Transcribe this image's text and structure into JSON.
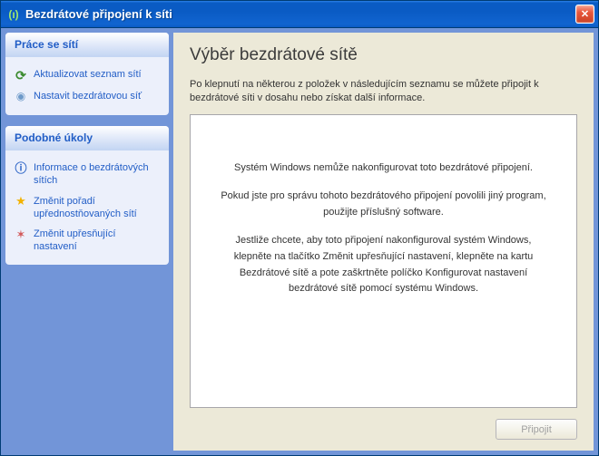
{
  "window": {
    "title": "Bezdrátové připojení k síti"
  },
  "sidebar": {
    "panel1": {
      "header": "Práce se sítí",
      "links": [
        {
          "label": "Aktualizovat seznam sítí"
        },
        {
          "label": "Nastavit bezdrátovou síť"
        }
      ]
    },
    "panel2": {
      "header": "Podobné úkoly",
      "links": [
        {
          "label": "Informace o bezdrátových sítích"
        },
        {
          "label": "Změnit pořadí upřednostňovaných sítí"
        },
        {
          "label": "Změnit upřesňující nastavení"
        }
      ]
    }
  },
  "content": {
    "heading": "Výběr bezdrátové sítě",
    "description": "Po klepnutí na některou z položek v následujícím seznamu se můžete připojit k bezdrátové síti v dosahu nebo získat další informace.",
    "message1": "Systém Windows nemůže nakonfigurovat toto bezdrátové připojení.",
    "message2": "Pokud jste pro správu tohoto bezdrátového připojení povolili jiný program, použijte příslušný software.",
    "message3": "Jestliže chcete, aby toto připojení nakonfiguroval systém Windows, klepněte na tlačítko Změnit upřesňující nastavení, klepněte na kartu Bezdrátové sítě a pote zaškrtněte políčko Konfigurovat nastavení bezdrátové sítě pomocí systému Windows."
  },
  "buttons": {
    "connect": "Připojit"
  }
}
